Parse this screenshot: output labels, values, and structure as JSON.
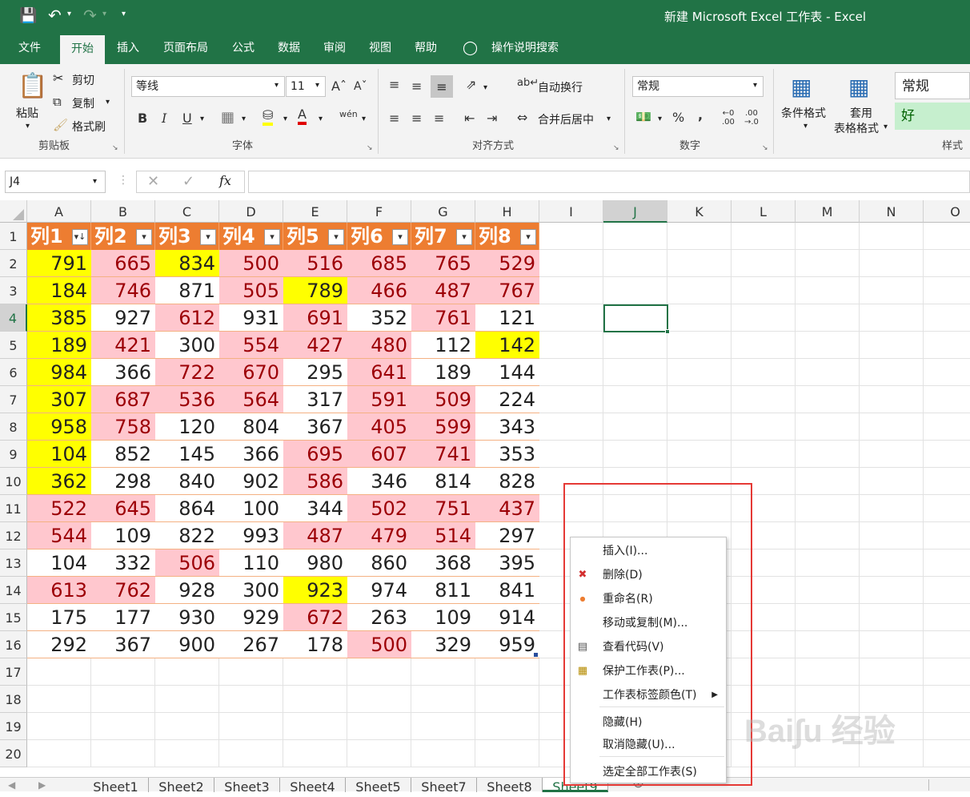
{
  "window": {
    "title": "新建 Microsoft Excel 工作表  -  Excel",
    "save_icon": "save-icon",
    "undo_icon": "undo-icon",
    "redo_icon": "redo-icon"
  },
  "ribbon_tabs": [
    "文件",
    "开始",
    "插入",
    "页面布局",
    "公式",
    "数据",
    "审阅",
    "视图",
    "帮助",
    "操作说明搜索"
  ],
  "clipboard": {
    "paste": "粘贴",
    "cut": "剪切",
    "copy": "复制",
    "format_painter": "格式刷",
    "group": "剪贴板"
  },
  "font": {
    "name": "等线",
    "size": "11",
    "group": "字体",
    "bold": "B",
    "italic": "I",
    "underline": "U",
    "font_color": "A",
    "wen": "wén"
  },
  "alignment": {
    "wrap": "自动换行",
    "merge": "合并后居中",
    "group": "对齐方式"
  },
  "number": {
    "format": "常规",
    "percent": "%",
    "comma": ",",
    "group": "数字"
  },
  "styles": {
    "conditional": "条件格式",
    "table_format_1": "套用",
    "table_format_2": "表格格式",
    "normal": "常规",
    "good": "好",
    "group": "样式"
  },
  "formula_bar": {
    "name_box": "J4",
    "fx": "fx",
    "formula": ""
  },
  "columns": [
    "A",
    "B",
    "C",
    "D",
    "E",
    "F",
    "G",
    "H",
    "I",
    "J",
    "K",
    "L",
    "M",
    "N",
    "O"
  ],
  "rows": [
    "1",
    "2",
    "3",
    "4",
    "5",
    "6",
    "7",
    "8",
    "9",
    "10",
    "11",
    "12",
    "13",
    "14",
    "15",
    "16",
    "17",
    "18",
    "19",
    "20"
  ],
  "table_headers": [
    "列1",
    "列2",
    "列3",
    "列4",
    "列5",
    "列6",
    "列7",
    "列8"
  ],
  "table_rows": [
    [
      [
        "791",
        "y"
      ],
      [
        "665",
        "p"
      ],
      [
        "834",
        "y"
      ],
      [
        "500",
        "p"
      ],
      [
        "516",
        "p"
      ],
      [
        "685",
        "p"
      ],
      [
        "765",
        "p"
      ],
      [
        "529",
        "p"
      ]
    ],
    [
      [
        "184",
        "y"
      ],
      [
        "746",
        "p"
      ],
      [
        "871",
        "w"
      ],
      [
        "505",
        "p"
      ],
      [
        "789",
        "y"
      ],
      [
        "466",
        "p"
      ],
      [
        "487",
        "p"
      ],
      [
        "767",
        "p"
      ]
    ],
    [
      [
        "385",
        "y"
      ],
      [
        "927",
        "w"
      ],
      [
        "612",
        "p"
      ],
      [
        "931",
        "w"
      ],
      [
        "691",
        "p"
      ],
      [
        "352",
        "w"
      ],
      [
        "761",
        "p"
      ],
      [
        "121",
        "w"
      ]
    ],
    [
      [
        "189",
        "y"
      ],
      [
        "421",
        "p"
      ],
      [
        "300",
        "w"
      ],
      [
        "554",
        "p"
      ],
      [
        "427",
        "p"
      ],
      [
        "480",
        "p"
      ],
      [
        "112",
        "w"
      ],
      [
        "142",
        "y"
      ]
    ],
    [
      [
        "984",
        "y"
      ],
      [
        "366",
        "w"
      ],
      [
        "722",
        "p"
      ],
      [
        "670",
        "p"
      ],
      [
        "295",
        "w"
      ],
      [
        "641",
        "p"
      ],
      [
        "189",
        "w"
      ],
      [
        "144",
        "w"
      ]
    ],
    [
      [
        "307",
        "y"
      ],
      [
        "687",
        "p"
      ],
      [
        "536",
        "p"
      ],
      [
        "564",
        "p"
      ],
      [
        "317",
        "w"
      ],
      [
        "591",
        "p"
      ],
      [
        "509",
        "p"
      ],
      [
        "224",
        "w"
      ]
    ],
    [
      [
        "958",
        "y"
      ],
      [
        "758",
        "p"
      ],
      [
        "120",
        "w"
      ],
      [
        "804",
        "w"
      ],
      [
        "367",
        "w"
      ],
      [
        "405",
        "p"
      ],
      [
        "599",
        "p"
      ],
      [
        "343",
        "w"
      ]
    ],
    [
      [
        "104",
        "y"
      ],
      [
        "852",
        "w"
      ],
      [
        "145",
        "w"
      ],
      [
        "366",
        "w"
      ],
      [
        "695",
        "p"
      ],
      [
        "607",
        "p"
      ],
      [
        "741",
        "p"
      ],
      [
        "353",
        "w"
      ]
    ],
    [
      [
        "362",
        "y"
      ],
      [
        "298",
        "w"
      ],
      [
        "840",
        "w"
      ],
      [
        "902",
        "w"
      ],
      [
        "586",
        "p"
      ],
      [
        "346",
        "w"
      ],
      [
        "814",
        "w"
      ],
      [
        "828",
        "w"
      ]
    ],
    [
      [
        "522",
        "p"
      ],
      [
        "645",
        "p"
      ],
      [
        "864",
        "w"
      ],
      [
        "100",
        "w"
      ],
      [
        "344",
        "w"
      ],
      [
        "502",
        "p"
      ],
      [
        "751",
        "p"
      ],
      [
        "437",
        "p"
      ]
    ],
    [
      [
        "544",
        "p"
      ],
      [
        "109",
        "w"
      ],
      [
        "822",
        "w"
      ],
      [
        "993",
        "w"
      ],
      [
        "487",
        "p"
      ],
      [
        "479",
        "p"
      ],
      [
        "514",
        "p"
      ],
      [
        "297",
        "w"
      ]
    ],
    [
      [
        "104",
        "w"
      ],
      [
        "332",
        "w"
      ],
      [
        "506",
        "p"
      ],
      [
        "110",
        "w"
      ],
      [
        "980",
        "w"
      ],
      [
        "860",
        "w"
      ],
      [
        "368",
        "w"
      ],
      [
        "395",
        "w"
      ]
    ],
    [
      [
        "613",
        "p"
      ],
      [
        "762",
        "p"
      ],
      [
        "928",
        "w"
      ],
      [
        "300",
        "w"
      ],
      [
        "923",
        "y"
      ],
      [
        "974",
        "w"
      ],
      [
        "811",
        "w"
      ],
      [
        "841",
        "w"
      ]
    ],
    [
      [
        "175",
        "w"
      ],
      [
        "177",
        "w"
      ],
      [
        "930",
        "w"
      ],
      [
        "929",
        "w"
      ],
      [
        "672",
        "p"
      ],
      [
        "263",
        "w"
      ],
      [
        "109",
        "w"
      ],
      [
        "914",
        "w"
      ]
    ],
    [
      [
        "292",
        "w"
      ],
      [
        "367",
        "w"
      ],
      [
        "900",
        "w"
      ],
      [
        "267",
        "w"
      ],
      [
        "178",
        "w"
      ],
      [
        "500",
        "p"
      ],
      [
        "329",
        "w"
      ],
      [
        "959",
        "w"
      ]
    ]
  ],
  "sheet_tabs": [
    "Sheet1",
    "Sheet2",
    "Sheet3",
    "Sheet4",
    "Sheet5",
    "Sheet7",
    "Sheet8",
    "Sheet9"
  ],
  "context_menu": [
    {
      "label": "插入(I)...",
      "icon": ""
    },
    {
      "label": "删除(D)",
      "icon": "delete-sheet-icon"
    },
    {
      "label": "重命名(R)",
      "icon": "rename-dot-icon"
    },
    {
      "label": "移动或复制(M)...",
      "icon": ""
    },
    {
      "label": "查看代码(V)",
      "icon": "view-code-icon"
    },
    {
      "label": "保护工作表(P)...",
      "icon": "protect-sheet-icon"
    },
    {
      "label": "工作表标签颜色(T)",
      "icon": "",
      "submenu": true
    },
    {
      "label": "隐藏(H)",
      "icon": ""
    },
    {
      "label": "取消隐藏(U)...",
      "icon": ""
    },
    {
      "label": "选定全部工作表(S)",
      "icon": ""
    }
  ],
  "colors": {
    "excel_green": "#217346",
    "table_orange": "#ed7d31",
    "pink_fill": "#ffc7ce",
    "pink_text": "#9c0006",
    "yellow_fill": "#ffff00",
    "highlight_red": "#e53935"
  }
}
